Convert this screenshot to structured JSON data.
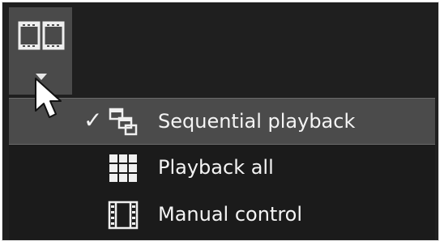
{
  "toolbar": {
    "view_button_icon": "film-strip-icon",
    "dropdown_icon": "caret-down-icon"
  },
  "menu": {
    "items": [
      {
        "label": "Sequential playback",
        "icon": "sequential-frames-icon",
        "checked": true
      },
      {
        "label": "Playback all",
        "icon": "grid-icon",
        "checked": false
      },
      {
        "label": "Manual control",
        "icon": "film-frame-icon",
        "checked": false
      }
    ],
    "check_mark": "✓"
  }
}
